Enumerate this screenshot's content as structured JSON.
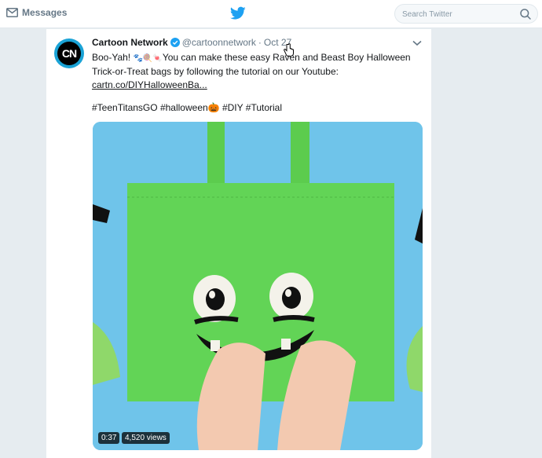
{
  "nav": {
    "messages_label": "Messages",
    "search_placeholder": "Search Twitter"
  },
  "tweet": {
    "author_name": "Cartoon Network",
    "avatar_text": "CN",
    "handle": "@cartoonnetwork",
    "separator": "·",
    "time": "Oct 27",
    "text_1": "Boo-Yah! ",
    "text_emoji": "🐾🍭🍬",
    "text_2": "You can make these easy Raven and Beast Boy Halloween Trick-or-Treat bags by following the tutorial on our Youtube:",
    "link": "cartn.co/DIYHalloweenBa...",
    "hashtags": [
      "#TeenTitansGO",
      "#halloween🎃",
      "#DIY",
      "#Tutorial"
    ],
    "video_duration": "0:37",
    "video_views": "4,520 views"
  },
  "colors": {
    "twitter_blue": "#1da1f2",
    "bag_green": "#62d456",
    "background_blue": "#6fc4ea"
  }
}
